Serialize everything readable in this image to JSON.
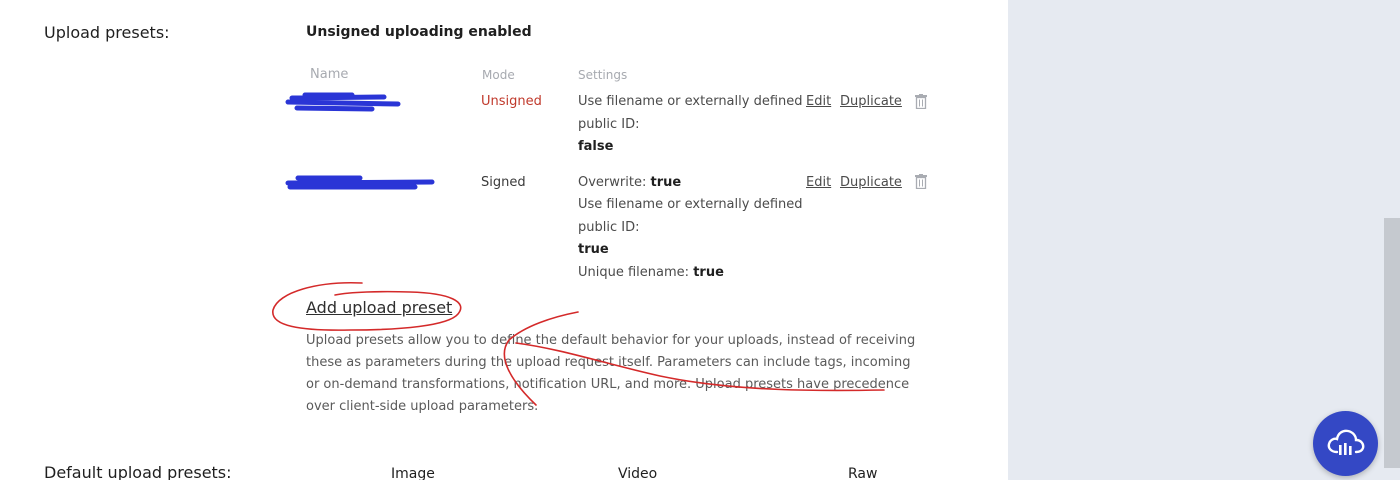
{
  "section": {
    "title": "Upload presets:",
    "status": "Unsigned uploading enabled"
  },
  "table": {
    "headers": {
      "name": "Name",
      "mode": "Mode",
      "settings": "Settings"
    },
    "rows": [
      {
        "mode": "Unsigned",
        "settings": {
          "line1": "Use filename or externally defined",
          "line2": "public ID:",
          "line3_value": "false"
        },
        "edit_label": "Edit",
        "duplicate_label": "Duplicate"
      },
      {
        "mode": "Signed",
        "settings": {
          "overwrite_label": "Overwrite:",
          "overwrite_value": "true",
          "line2": "Use filename or externally defined",
          "line3": "public ID:",
          "line4_value": "true",
          "unique_label": "Unique filename:",
          "unique_value": "true"
        },
        "edit_label": "Edit",
        "duplicate_label": "Duplicate"
      }
    ]
  },
  "add_preset_label": "Add upload preset",
  "description": "Upload presets allow you to define the default behavior for your uploads, instead of receiving these as parameters during the upload request itself. Parameters can include tags, incoming or on-demand transformations, notification URL, and more. Upload presets have precedence over client-side upload parameters.",
  "default_presets": {
    "title": "Default upload presets:",
    "columns": [
      "Image",
      "Video",
      "Raw"
    ]
  },
  "icons": {
    "delete": "trash-icon",
    "assistant": "cloud-chat-icon"
  },
  "colors": {
    "accent": "#3448c5",
    "unsigned_mode": "#c0392b",
    "annotation_red": "#d42a2a",
    "redaction_blue": "#2a35d6",
    "side_panel": "#e6eaf1"
  }
}
